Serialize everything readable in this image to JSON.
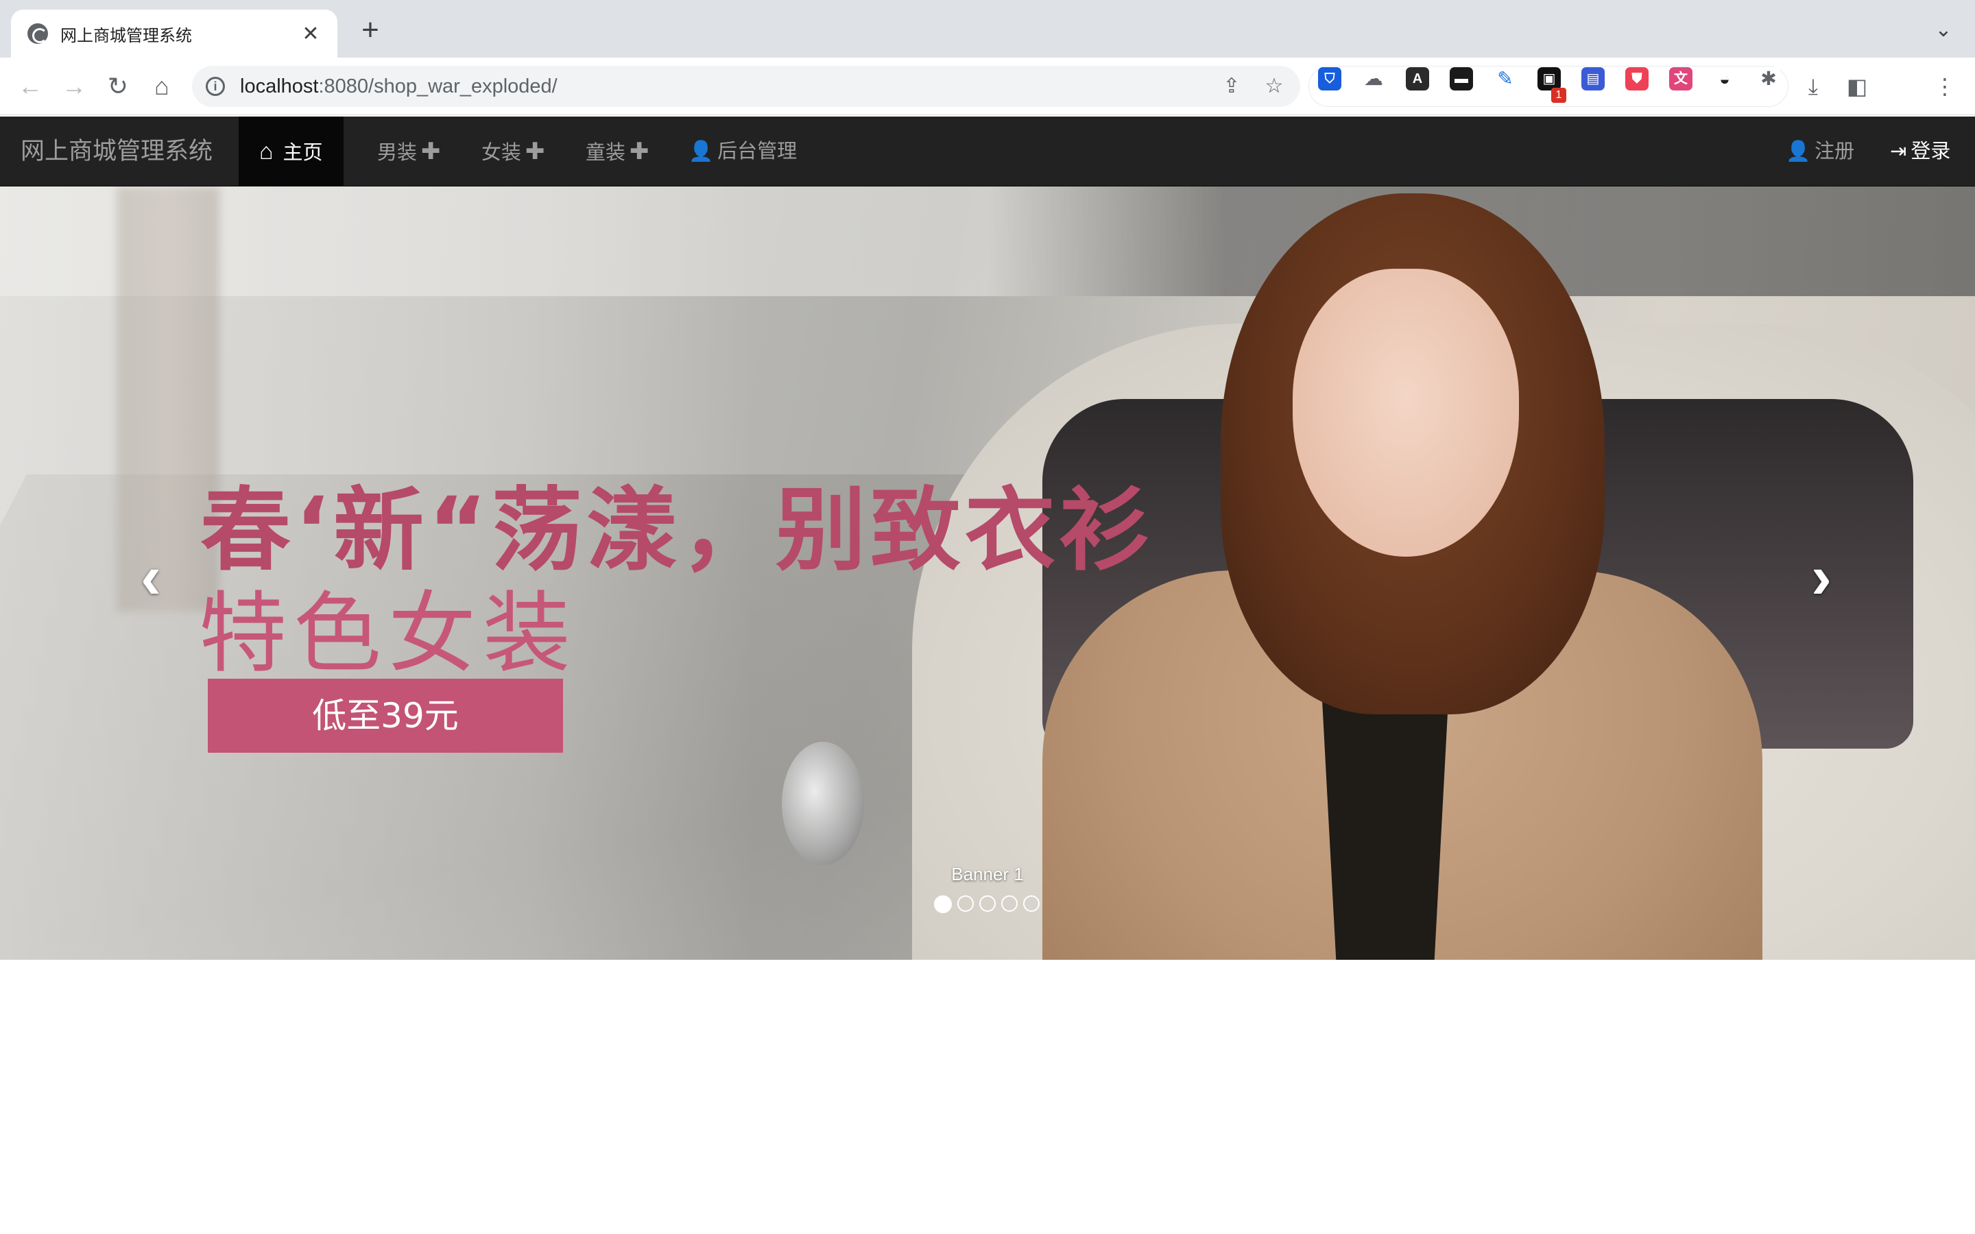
{
  "browser": {
    "tab_title": "网上商城管理系统",
    "tab_close": "✕",
    "new_tab": "+",
    "tab_menu": "⌄",
    "url_host": "localhost",
    "url_rest": ":8080/shop_war_exploded/",
    "badge_count": "1"
  },
  "navbar": {
    "brand": "网上商城管理系统",
    "items": [
      {
        "label": "主页",
        "icon": "home-icon"
      },
      {
        "label": "男装",
        "icon": "plus-icon"
      },
      {
        "label": "女装",
        "icon": "plus-icon"
      },
      {
        "label": "童装",
        "icon": "plus-icon"
      },
      {
        "label": "后台管理",
        "icon": "user-icon"
      }
    ],
    "register": "注册",
    "login": "登录"
  },
  "carousel": {
    "headline": "春‘新“荡漾，别致衣衫",
    "subline": "特色女装",
    "cta": "低至39元",
    "caption": "Banner 1",
    "slide_count": 5,
    "active_index": 0
  },
  "colors": {
    "navbar_bg": "#222222",
    "accent_pink": "#c35476"
  }
}
